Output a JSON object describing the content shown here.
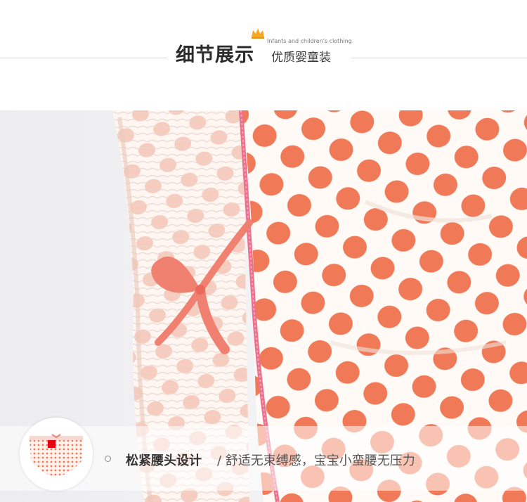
{
  "header": {
    "title": "细节展示",
    "subtitle_en": "Infants and children's clothing",
    "subtitle_cn": "优质婴童装"
  },
  "caption": {
    "feature": "松紧腰头设计",
    "separator": " / ",
    "description": "舒适无束缚感，宝宝小蛮腰无压力"
  },
  "colors": {
    "dot": "#f07a58",
    "piping": "#ec6f8c",
    "bow": "#f08070",
    "fabric": "#fffaf5",
    "crown": "#f5a623"
  },
  "icons": {
    "crown": "crown-icon",
    "bullet": "circle-bullet-icon"
  }
}
